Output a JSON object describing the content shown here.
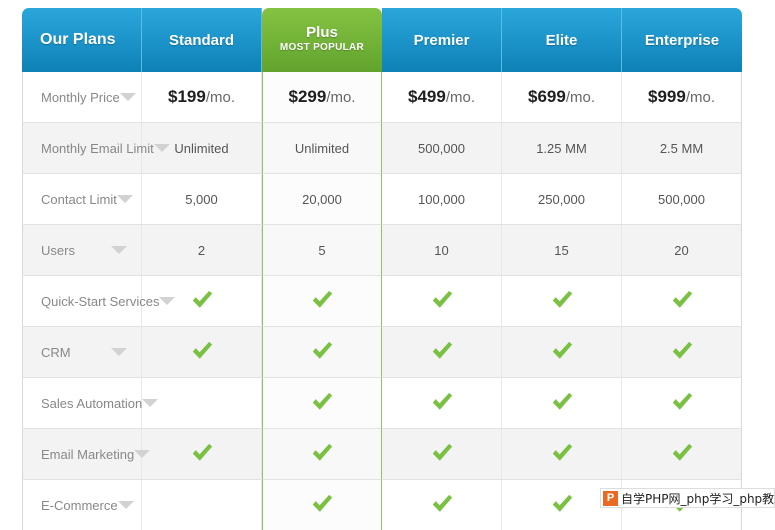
{
  "table": {
    "columns": [
      {
        "key": "feature",
        "label": "Our Plans",
        "featured": false,
        "badge": ""
      },
      {
        "key": "standard",
        "label": "Standard",
        "featured": false,
        "badge": ""
      },
      {
        "key": "plus",
        "label": "Plus",
        "featured": true,
        "badge": "MOST POPULAR"
      },
      {
        "key": "premier",
        "label": "Premier",
        "featured": false,
        "badge": ""
      },
      {
        "key": "elite",
        "label": "Elite",
        "featured": false,
        "badge": ""
      },
      {
        "key": "enterprise",
        "label": "Enterprise",
        "featured": false,
        "badge": ""
      }
    ],
    "rows": [
      {
        "label": "Monthly Price",
        "type": "price",
        "values": [
          {
            "amount": "$199",
            "per": "/mo."
          },
          {
            "amount": "$299",
            "per": "/mo."
          },
          {
            "amount": "$499",
            "per": "/mo."
          },
          {
            "amount": "$699",
            "per": "/mo."
          },
          {
            "amount": "$999",
            "per": "/mo."
          }
        ]
      },
      {
        "label": "Monthly Email Limit",
        "type": "text",
        "values": [
          "Unlimited",
          "Unlimited",
          "500,000",
          "1.25 MM",
          "2.5 MM"
        ]
      },
      {
        "label": "Contact Limit",
        "type": "text",
        "values": [
          "5,000",
          "20,000",
          "100,000",
          "250,000",
          "500,000"
        ]
      },
      {
        "label": "Users",
        "type": "text",
        "values": [
          "2",
          "5",
          "10",
          "15",
          "20"
        ]
      },
      {
        "label": "Quick-Start Services",
        "type": "check",
        "values": [
          true,
          true,
          true,
          true,
          true
        ]
      },
      {
        "label": "CRM",
        "type": "check",
        "values": [
          true,
          true,
          true,
          true,
          true
        ]
      },
      {
        "label": "Sales Automation",
        "type": "check",
        "values": [
          false,
          true,
          true,
          true,
          true
        ]
      },
      {
        "label": "Email Marketing",
        "type": "check",
        "values": [
          true,
          true,
          true,
          true,
          true
        ]
      },
      {
        "label": "E-Commerce",
        "type": "check",
        "values": [
          false,
          true,
          true,
          true,
          true
        ]
      }
    ]
  },
  "icons": {
    "caret": "chevron-down-icon",
    "check": "checkmark-icon"
  },
  "colors": {
    "header_blue": "#1d96cc",
    "featured_green": "#71b237",
    "check_green": "#7ac143",
    "row_stripe": "#f3f3f3",
    "label_text": "#888888"
  },
  "watermark": {
    "logo_letter": "P",
    "text": "自学PHP网_php学习_php教"
  }
}
